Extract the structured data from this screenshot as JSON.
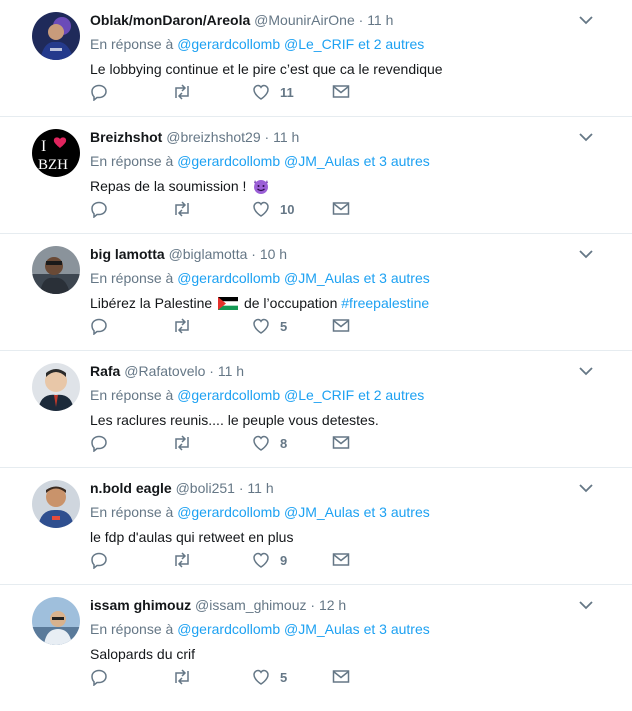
{
  "tweets": [
    {
      "name": "Oblak/monDaron/Areola",
      "handle": "@MounirAirOne",
      "time": "11 h",
      "reply_prefix": "En réponse à",
      "reply_users": [
        "@gerardcollomb",
        "@Le_CRIF"
      ],
      "reply_suffix": "et 2 autres",
      "text": "Le lobbying continue et le pire c’est que ca le revendique",
      "likes": "11",
      "avatar_color": "#3b3f8c"
    },
    {
      "name": "Breizhshot",
      "handle": "@breizhshot29",
      "time": "11 h",
      "reply_prefix": "En réponse à",
      "reply_users": [
        "@gerardcollomb",
        "@JM_Aulas"
      ],
      "reply_suffix": "et 3 autres",
      "text": "Repas de la soumission !",
      "likes": "10",
      "avatar_color": "#000000",
      "avatar_text_top": "I",
      "avatar_text_bottom": "BZH"
    },
    {
      "name": "big lamotta",
      "handle": "@biglamotta",
      "time": "10 h",
      "reply_prefix": "En réponse à",
      "reply_users": [
        "@gerardcollomb",
        "@JM_Aulas"
      ],
      "reply_suffix": "et 3 autres",
      "text_before": "Libérez la Palestine",
      "text_after": "de l’occupation",
      "hashtag": "#freepalestine",
      "likes": "5",
      "avatar_color": "#5b6670"
    },
    {
      "name": "Rafa",
      "handle": "@Rafatovelo",
      "time": "11 h",
      "reply_prefix": "En réponse à",
      "reply_users": [
        "@gerardcollomb",
        "@Le_CRIF"
      ],
      "reply_suffix": "et 2 autres",
      "text": "Les raclures reunis.... le peuple vous detestes.",
      "likes": "8",
      "avatar_color": "#2c3e50"
    },
    {
      "name": "n.bold eagle",
      "handle": "@boli251",
      "time": "11 h",
      "reply_prefix": "En réponse à",
      "reply_users": [
        "@gerardcollomb",
        "@JM_Aulas"
      ],
      "reply_suffix": "et 3 autres",
      "text": "le fdp d'aulas qui retweet en plus",
      "likes": "9",
      "avatar_color": "#2f4f8f"
    },
    {
      "name": "issam ghimouz",
      "handle": "@issam_ghimouz",
      "time": "12 h",
      "reply_prefix": "En réponse à",
      "reply_users": [
        "@gerardcollomb",
        "@JM_Aulas"
      ],
      "reply_suffix": "et 3 autres",
      "text": "Salopards du crif",
      "likes": "5",
      "avatar_color": "#7fa6c8"
    }
  ],
  "colors": {
    "link": "#1da1f2",
    "muted": "#657786",
    "border": "#e6ecf0"
  },
  "icons": [
    "reply-icon",
    "retweet-icon",
    "like-icon",
    "direct-message-icon",
    "chevron-down-icon"
  ]
}
